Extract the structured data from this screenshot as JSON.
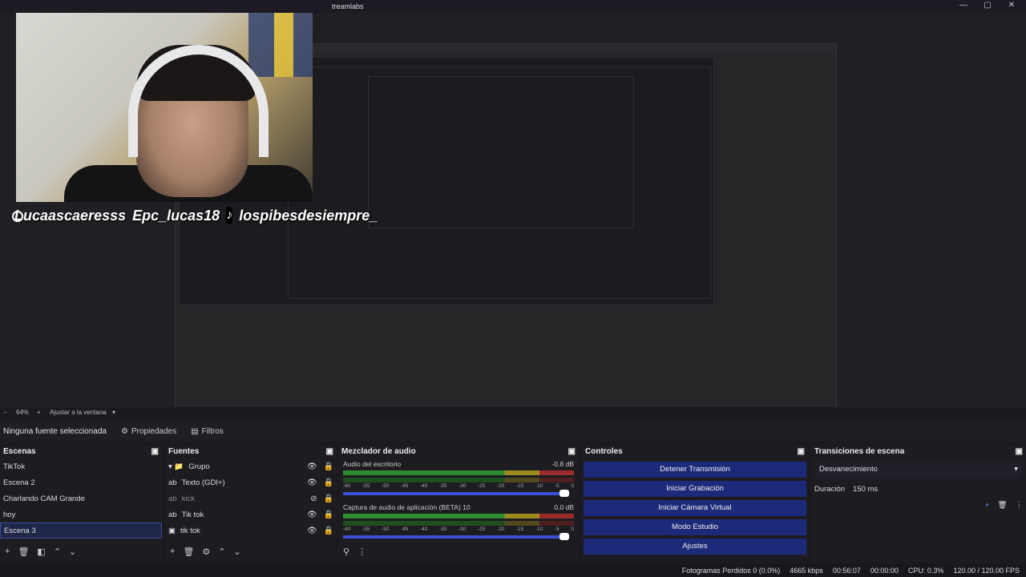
{
  "window": {
    "title": "treamlabs",
    "min": "—",
    "max": "▢",
    "close": "✕"
  },
  "social": {
    "handle1": "Lucaascaeresss",
    "handle2": "Epc_lucas18",
    "handle3": "lospibesdesiempre_"
  },
  "zoom": {
    "minus": "−",
    "value": "64%",
    "plus": "+",
    "fit": "Ajustar a la ventana"
  },
  "props": {
    "selected": "Ninguna fuente seleccionada",
    "properties": "Propiedades",
    "filters": "Filtros"
  },
  "scenes": {
    "title": "Escenas",
    "items": [
      "TikTok",
      "Escena 2",
      "Charlando CAM Grande",
      "hoy",
      "Escena 3"
    ]
  },
  "sources": {
    "title": "Fuentes",
    "items": [
      "Grupo",
      "Texto (GDI+)",
      "kick",
      "Tik tok",
      "tik tok"
    ]
  },
  "mixer": {
    "title": "Mezclador de audio",
    "channels": [
      {
        "name": "Audio del escritorio",
        "db": "-0.8 dB"
      },
      {
        "name": "Captura de audio de aplicación (BETA) 10",
        "db": "0.0 dB"
      }
    ],
    "scale": [
      "-60",
      "-55",
      "-50",
      "-45",
      "-40",
      "-35",
      "-30",
      "-25",
      "-20",
      "-15",
      "-10",
      "-5",
      "0"
    ]
  },
  "controls": {
    "title": "Controles",
    "buttons": [
      "Detener Transmisión",
      "Iniciar Grabación",
      "Iniciar Cámara Virtual",
      "Modo Estudio",
      "Ajustes"
    ]
  },
  "transitions": {
    "title": "Transiciones de escena",
    "type": "Desvanecimiento",
    "duration_label": "Duración",
    "duration": "150 ms"
  },
  "status": {
    "dropped": "Fotogramas Perdidos 0 (0.0%)",
    "bitrate": "4665 kbps",
    "stream_time": "00:56:07",
    "rec_time": "00:00:00",
    "cpu": "CPU: 0.3%",
    "fps": "120.00 / 120.00 FPS"
  }
}
